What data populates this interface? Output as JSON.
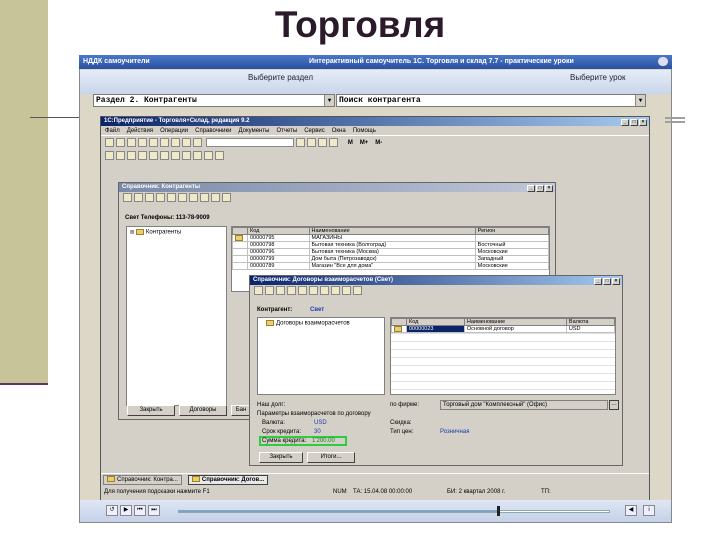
{
  "slide_title": "Торговля",
  "tutor": {
    "app_name": "НДДК самоучители",
    "title": "Интерактивный самоучитель 1С. Торговля и склад 7.7 - практические уроки",
    "choose_section_label": "Выберите раздел",
    "choose_lesson_label": "Выберите урок",
    "section_value": "Раздел 2. Контрагенты",
    "lesson_value": "Поиск контрагента"
  },
  "app": {
    "title": "1С:Предприятие - Торговля+Склад, редакция 9.2",
    "menu": [
      "Файл",
      "Действия",
      "Операции",
      "Справочники",
      "Документы",
      "Отчеты",
      "Сервис",
      "Окна",
      "Помощь"
    ],
    "toolbar_labels": [
      "М",
      "М+",
      "М-"
    ]
  },
  "kontragenty": {
    "title": "Справочник: Контрагенты",
    "info": "Свет  Телефоны: 113-78-9009",
    "tree_root": "Контрагенты",
    "columns": [
      "Код",
      "Наименование",
      "Регион"
    ],
    "rows": [
      [
        "00000795",
        "МАГАЗИНЫ",
        ""
      ],
      [
        "00000798",
        "Бытовая техника (Волгоград)",
        "Восточный"
      ],
      [
        "00000796",
        "Бытовая техника (Москва)",
        "Московские"
      ],
      [
        "00000799",
        "Дом быта (Петрозаводск)",
        "Западный"
      ],
      [
        "00000789",
        "Магазин \"Все для дома\"",
        "Московские"
      ]
    ],
    "buttons": [
      "Закрыть",
      "Договоры",
      "Бан"
    ]
  },
  "dogovory": {
    "title": "Справочник: Договоры взаиморасчетов (Свет)",
    "kontragent_label": "Контрагент:",
    "kontragent_value": "Свет",
    "tree_item": "Договоры взаиморасчетов",
    "columns": [
      "Код",
      "Наименование",
      "Валюта"
    ],
    "rows": [
      [
        "00000023",
        "Основной договор",
        "USD"
      ]
    ],
    "nash_dolg_label": "Наш долг:",
    "po_firme_label": "по фирме:",
    "firm_value": "Торговый дом \"Комплексный\" (Офис)",
    "params_title": "Параметры взаиморасчетов по договору",
    "valuta_label": "Валюта:",
    "valuta_value": "USD",
    "skidka_label": "Скидка:",
    "srok_label": "Срок кредита:",
    "srok_value": "30",
    "tip_cen_label": "Тип цен:",
    "tip_cen_value": "Розничная",
    "summa_label": "Сумма кредита:",
    "summa_value": "1'200.00",
    "buttons": [
      "Закрыть",
      "Итоги..."
    ]
  },
  "taskbar": [
    "Справочник: Контра...",
    "Справочник: Догов..."
  ],
  "status": {
    "hint": "Для получения подсказки нажмите F1",
    "num": "NUM",
    "ta": "ТА: 15.04.08 00:00:00",
    "bi": "БИ: 2 квартал 2008 г.",
    "tp": "ТП:"
  }
}
